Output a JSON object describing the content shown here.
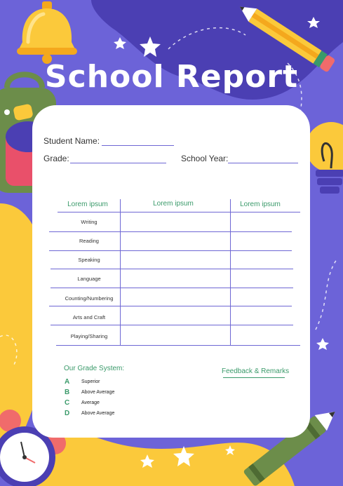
{
  "title": "School Report",
  "student_fields": {
    "student_name_label": "Student Name:",
    "grade_label": "Grade:",
    "school_year_label": "School Year:"
  },
  "table": {
    "headers": [
      "Lorem ipsum",
      "Lorem ipsum",
      "Lorem ipsum"
    ],
    "rows": [
      "Writing",
      "Reading",
      "Speaking",
      "Language",
      "Counting/Numbering",
      "Arts and Craft",
      "Playing/Sharing"
    ]
  },
  "grade_system": {
    "title": "Our Grade System:",
    "items": [
      {
        "letter": "A",
        "description": "Superior"
      },
      {
        "letter": "B",
        "description": "Above Average"
      },
      {
        "letter": "C",
        "description": "Average"
      },
      {
        "letter": "D",
        "description": "Above Average"
      }
    ]
  },
  "feedback": {
    "title": "Feedback & Remarks"
  },
  "colors": {
    "background": "#6c63d8",
    "accent_green": "#3a9a6a",
    "line_purple": "#6e67d4",
    "yellow": "#fbc93b"
  },
  "decorations": [
    "bell-icon",
    "backpack-icon",
    "pencil-icon",
    "lightbulb-icon",
    "alarm-clock-icon",
    "crayon-icon",
    "star-icon"
  ]
}
